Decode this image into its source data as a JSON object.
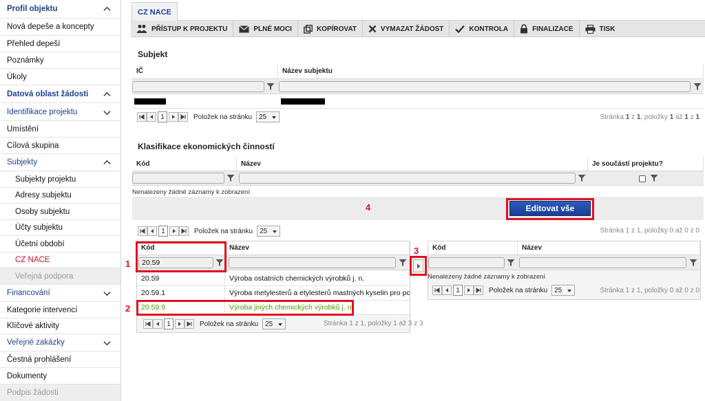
{
  "sidebar": {
    "items": [
      {
        "label": "Profil objektu"
      },
      {
        "label": "Nová depeše a koncepty"
      },
      {
        "label": "Přehled depeší"
      },
      {
        "label": "Poznámky"
      },
      {
        "label": "Úkoly"
      },
      {
        "label": "Datová oblast žádosti"
      },
      {
        "label": "Identifikace projektu"
      },
      {
        "label": "Umístění"
      },
      {
        "label": "Cílová skupina"
      },
      {
        "label": "Subjekty"
      },
      {
        "label": "Subjekty projektu"
      },
      {
        "label": "Adresy subjektu"
      },
      {
        "label": "Osoby subjektu"
      },
      {
        "label": "Účty subjektu"
      },
      {
        "label": "Účetní období"
      },
      {
        "label": "CZ NACE"
      },
      {
        "label": "Veřejná podpora"
      },
      {
        "label": "Financování"
      },
      {
        "label": "Kategorie intervencí"
      },
      {
        "label": "Klíčové aktivity"
      },
      {
        "label": "Veřejné zakázky"
      },
      {
        "label": "Čestná prohlášení"
      },
      {
        "label": "Dokumenty"
      },
      {
        "label": "Podpis žádosti"
      }
    ]
  },
  "tab": {
    "label": "CZ NACE"
  },
  "toolbar": {
    "buttons": [
      {
        "label": "PŘÍSTUP K PROJEKTU",
        "icon": "people-icon"
      },
      {
        "label": "PLNÉ MOCI",
        "icon": "envelope-icon"
      },
      {
        "label": "KOPÍROVAT",
        "icon": "copy-icon"
      },
      {
        "label": "VYMAZAT ŽÁDOST",
        "icon": "x-icon"
      },
      {
        "label": "KONTROLA",
        "icon": "check-icon"
      },
      {
        "label": "FINALIZACE",
        "icon": "lock-icon"
      },
      {
        "label": "TISK",
        "icon": "printer-icon"
      }
    ]
  },
  "subjekt": {
    "title": "Subjekt",
    "col_ic": "IČ",
    "col_name": "Název subjektu",
    "pager": {
      "page": "1",
      "per_page_label": "Položek na stránku",
      "per_page": "25",
      "info_prefix": "Stránka",
      "info_page": "1",
      "info_of": "z",
      "info_pages": "1",
      "info_items": ", položky",
      "info_from": "1",
      "info_to_word": "až",
      "info_to": "1",
      "info_total": "1"
    }
  },
  "klasifikace": {
    "title": "Klasifikace ekonomických činností",
    "col_kod": "Kód",
    "col_nazev": "Název",
    "col_soucast": "Je součástí projektu?",
    "no_data": "Nenalezeny žádné záznamy k zobrazení"
  },
  "edit_all": "Editovat vše",
  "top_pager": {
    "page": "1",
    "per_page_label": "Položek na stránku",
    "per_page": "25",
    "info": "Stránka 1 z 1, položky 0 až 0 z 0"
  },
  "left_list": {
    "col_kod": "Kód",
    "col_nazev": "Název",
    "filter_kod": "20.59",
    "rows": [
      {
        "kod": "20.59",
        "nazev": "Výroba ostatních chemických výrobků j. n."
      },
      {
        "kod": "20.59.1",
        "nazev": "Výroba metylesterů a etylesterů mastných kyselin pro po..."
      },
      {
        "kod": "20.59.9",
        "nazev": "Výroba jiných chemických výrobků j. n."
      }
    ],
    "pager": {
      "page": "1",
      "per_page_label": "Položek na stránku",
      "per_page": "25",
      "info": "Stránka 1 z 1, položky 1 až 3 z 3"
    }
  },
  "right_list": {
    "col_kod": "Kód",
    "col_nazev": "Název",
    "no_data": "Nenalezeny žádné záznamy k zobrazení",
    "pager": {
      "page": "1",
      "per_page_label": "Položek na stránku",
      "per_page": "25",
      "info": "Stránka 1 z 1, položky 0 až 0 z 0"
    }
  },
  "markers": {
    "m1": "1",
    "m2": "2",
    "m3": "3",
    "m4": "4"
  },
  "colors": {
    "accent": "#1d3f8f",
    "active": "#c8102e",
    "highlight": "#e0101e",
    "green_row": "#4a9a00"
  }
}
